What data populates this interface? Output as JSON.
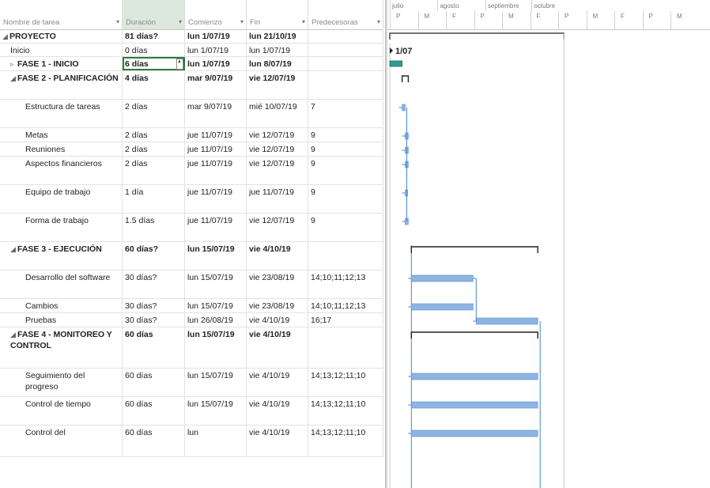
{
  "columns": [
    "Nombre de tarea",
    "Duración",
    "Comienzo",
    "Fin",
    "Predecesoras"
  ],
  "timeline": {
    "months": [
      "julio",
      "agosto",
      "septiembre",
      "octubre"
    ],
    "days": [
      "P",
      "M",
      "F",
      "P",
      "M",
      "F",
      "P",
      "M",
      "F",
      "P",
      "M"
    ],
    "start_label": "1/07"
  },
  "rows": [
    {
      "name": "PROYECTO",
      "duration": "81 días?",
      "start": "lun 1/07/19",
      "end": "lun 21/10/19",
      "pred": "",
      "bold": true,
      "indent": 0,
      "toggle": "◢",
      "h": 18
    },
    {
      "name": "Inicio",
      "duration": "0 días",
      "start": "lun 1/07/19",
      "end": "lun 1/07/19",
      "pred": "",
      "bold": false,
      "indent": 1,
      "toggle": "",
      "h": 17
    },
    {
      "name": "FASE 1 - INICIO",
      "duration": "6 días",
      "start": "lun 1/07/19",
      "end": "lun 8/07/19",
      "pred": "",
      "bold": true,
      "indent": 1,
      "toggle": "▹",
      "h": 18
    },
    {
      "name": "FASE 2 - PLANIFICACIÓN",
      "duration": "4 días",
      "start": "mar 9/07/19",
      "end": "vie 12/07/19",
      "pred": "",
      "bold": true,
      "indent": 1,
      "toggle": "◢",
      "h": 36
    },
    {
      "name": "Estructura de tareas",
      "duration": "2 días",
      "start": "mar 9/07/19",
      "end": "mié 10/07/19",
      "pred": "7",
      "bold": false,
      "indent": 2,
      "toggle": "",
      "h": 36
    },
    {
      "name": "Metas",
      "duration": "2 días",
      "start": "jue 11/07/19",
      "end": "vie 12/07/19",
      "pred": "9",
      "bold": false,
      "indent": 2,
      "toggle": "",
      "h": 18
    },
    {
      "name": "Reuniones",
      "duration": "2 días",
      "start": "jue 11/07/19",
      "end": "vie 12/07/19",
      "pred": "9",
      "bold": false,
      "indent": 2,
      "toggle": "",
      "h": 18
    },
    {
      "name": "Aspectos financieros",
      "duration": "2 días",
      "start": "jue 11/07/19",
      "end": "vie 12/07/19",
      "pred": "9",
      "bold": false,
      "indent": 2,
      "toggle": "",
      "h": 36
    },
    {
      "name": "Equipo de trabajo",
      "duration": "1 día",
      "start": "jue 11/07/19",
      "end": "jue 11/07/19",
      "pred": "9",
      "bold": false,
      "indent": 2,
      "toggle": "",
      "h": 36
    },
    {
      "name": "Forma de trabajo",
      "duration": "1.5 días",
      "start": "jue 11/07/19",
      "end": "vie 12/07/19",
      "pred": "9",
      "bold": false,
      "indent": 2,
      "toggle": "",
      "h": 36
    },
    {
      "name": "FASE 3 - EJECUCIÓN",
      "duration": "60 días?",
      "start": "lun 15/07/19",
      "end": "vie 4/10/19",
      "pred": "",
      "bold": true,
      "indent": 1,
      "toggle": "◢",
      "h": 36
    },
    {
      "name": "Desarrollo del software",
      "duration": "30 días?",
      "start": "lun 15/07/19",
      "end": "vie 23/08/19",
      "pred": "14;10;11;12;13",
      "bold": false,
      "indent": 2,
      "toggle": "",
      "h": 36
    },
    {
      "name": "Cambios",
      "duration": "30 días?",
      "start": "lun 15/07/19",
      "end": "vie 23/08/19",
      "pred": "14;10;11;12;13",
      "bold": false,
      "indent": 2,
      "toggle": "",
      "h": 18
    },
    {
      "name": "Pruebas",
      "duration": "30 días?",
      "start": "lun 26/08/19",
      "end": "vie 4/10/19",
      "pred": "16;17",
      "bold": false,
      "indent": 2,
      "toggle": "",
      "h": 18
    },
    {
      "name": "FASE 4 - MONITOREO Y CONTROL",
      "duration": "60 días",
      "start": "lun 15/07/19",
      "end": "vie 4/10/19",
      "pred": "",
      "bold": true,
      "indent": 1,
      "toggle": "◢",
      "h": 52
    },
    {
      "name": "Seguimiento del progreso",
      "duration": "60 días",
      "start": "lun 15/07/19",
      "end": "vie 4/10/19",
      "pred": "14;13;12;11;10",
      "bold": false,
      "indent": 2,
      "toggle": "",
      "h": 36
    },
    {
      "name": "Control de tiempo",
      "duration": "60 días",
      "start": "lun 15/07/19",
      "end": "vie 4/10/19",
      "pred": "14;13;12;11;10",
      "bold": false,
      "indent": 2,
      "toggle": "",
      "h": 36
    },
    {
      "name": "Control del",
      "duration": "60 días",
      "start": "lun",
      "end": "vie 4/10/19",
      "pred": "14;13;12;11;10",
      "bold": false,
      "indent": 2,
      "toggle": "",
      "h": 40
    }
  ],
  "gantt": {
    "project_start": "2019-07-01",
    "project_end": "2019-10-21",
    "tasks": [
      {
        "type": "summary-outline",
        "start": "2019-07-01",
        "end": "2019-10-21"
      },
      {
        "type": "milestone",
        "date": "2019-07-01"
      },
      {
        "type": "collapsed",
        "start": "2019-07-01",
        "end": "2019-07-08"
      },
      {
        "type": "summary",
        "start": "2019-07-09",
        "end": "2019-07-12"
      },
      {
        "type": "task",
        "start": "2019-07-09",
        "end": "2019-07-10"
      },
      {
        "type": "task",
        "start": "2019-07-11",
        "end": "2019-07-12"
      },
      {
        "type": "task",
        "start": "2019-07-11",
        "end": "2019-07-12"
      },
      {
        "type": "task",
        "start": "2019-07-11",
        "end": "2019-07-12"
      },
      {
        "type": "task",
        "start": "2019-07-11",
        "end": "2019-07-11"
      },
      {
        "type": "task",
        "start": "2019-07-11",
        "end": "2019-07-12"
      },
      {
        "type": "summary",
        "start": "2019-07-15",
        "end": "2019-10-04"
      },
      {
        "type": "task",
        "start": "2019-07-15",
        "end": "2019-08-23"
      },
      {
        "type": "task",
        "start": "2019-07-15",
        "end": "2019-08-23"
      },
      {
        "type": "task",
        "start": "2019-08-26",
        "end": "2019-10-04"
      },
      {
        "type": "summary",
        "start": "2019-07-15",
        "end": "2019-10-04"
      },
      {
        "type": "task",
        "start": "2019-07-15",
        "end": "2019-10-04"
      },
      {
        "type": "task",
        "start": "2019-07-15",
        "end": "2019-10-04"
      },
      {
        "type": "task",
        "start": "2019-07-15",
        "end": "2019-10-04"
      }
    ]
  },
  "colors": {
    "bar": "#8db4e2",
    "bar_border": "#5b8ed0",
    "summary": "#333333",
    "link": "#4a86c8",
    "collapsed": "#2e9b8f"
  }
}
